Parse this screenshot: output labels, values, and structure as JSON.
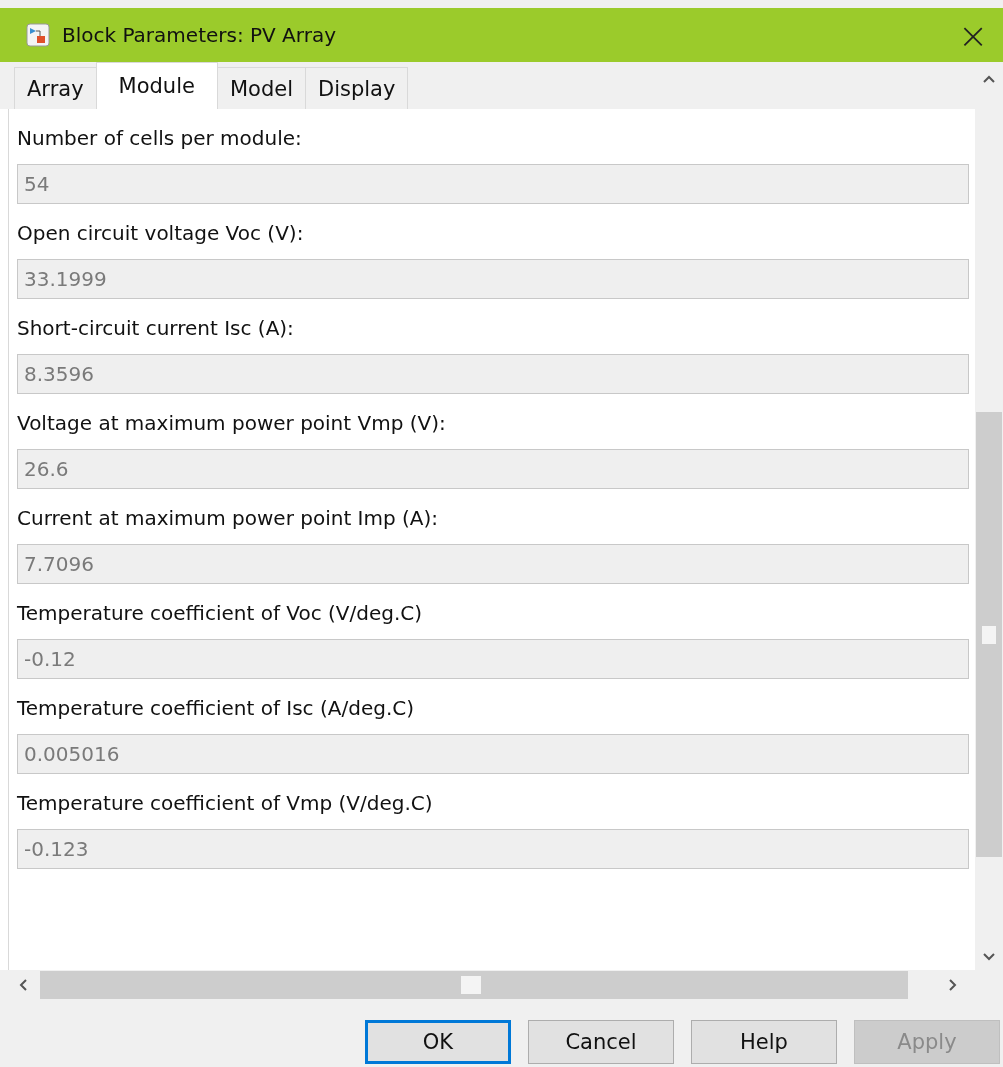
{
  "window": {
    "title": "Block Parameters: PV Array",
    "close": "×"
  },
  "tabs": [
    {
      "label": "Array",
      "selected": false
    },
    {
      "label": "Module",
      "selected": true
    },
    {
      "label": "Model",
      "selected": false
    },
    {
      "label": "Display",
      "selected": false
    }
  ],
  "parameters": [
    {
      "label": "Number of cells per module:",
      "value": "54",
      "disabled": true
    },
    {
      "label": "Open circuit voltage  Voc (V):",
      "value": "33.1999",
      "disabled": true
    },
    {
      "label": "Short-circuit current Isc (A):",
      "value": "8.3596",
      "disabled": true
    },
    {
      "label": "Voltage at maximum power point Vmp (V):",
      "value": "26.6",
      "disabled": true
    },
    {
      "label": "Current at maximum power point Imp (A):",
      "value": "7.7096",
      "disabled": true
    },
    {
      "label": "Temperature coefficient of Voc (V/deg.C)",
      "value": "-0.12",
      "disabled": true
    },
    {
      "label": "Temperature coefficient of Isc (A/deg.C)",
      "value": "0.005016",
      "disabled": true
    },
    {
      "label": "Temperature coefficient of Vmp (V/deg.C)",
      "value": "-0.123",
      "disabled": true
    }
  ],
  "buttons": [
    {
      "label": "OK",
      "focused": true,
      "disabled": false
    },
    {
      "label": "Cancel",
      "focused": false,
      "disabled": false
    },
    {
      "label": "Help",
      "focused": false,
      "disabled": false
    },
    {
      "label": "Apply",
      "focused": false,
      "disabled": true
    }
  ]
}
